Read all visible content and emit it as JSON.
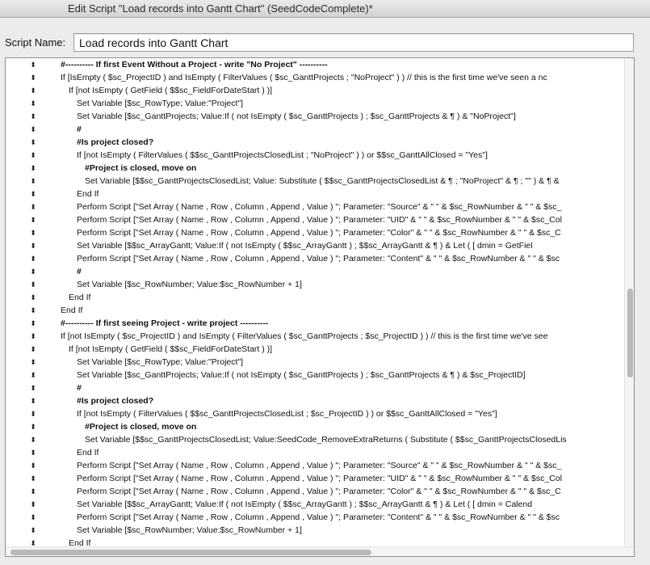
{
  "window": {
    "title": "Edit Script \"Load records into Gantt Chart\" (SeedCodeComplete)*"
  },
  "script_name": {
    "label": "Script Name:",
    "value": "Load records into Gantt Chart"
  },
  "handle_glyph": "⬍",
  "lines": [
    {
      "indent": 0,
      "comment": true,
      "text": "#----------  If first Event Without a Project - write \"No Project\"  ----------"
    },
    {
      "indent": 0,
      "comment": false,
      "text": "If [IsEmpty ( $sc_ProjectID )  and  IsEmpty ( FilterValues ( $sc_GanttProjects  ; \"NoProject\" ) ) // this is the first time we've seen a nc"
    },
    {
      "indent": 1,
      "comment": false,
      "text": "If [not IsEmpty ( GetField ( $$sc_FieldForDateStart ) )]"
    },
    {
      "indent": 2,
      "comment": false,
      "text": "Set Variable [$sc_RowType; Value:\"Project\"]"
    },
    {
      "indent": 2,
      "comment": false,
      "text": "Set Variable [$sc_GanttProjects; Value:If ( not IsEmpty ( $sc_GanttProjects ) ; $sc_GanttProjects & ¶ )  & \"NoProject\"]"
    },
    {
      "indent": 2,
      "comment": true,
      "text": "#"
    },
    {
      "indent": 2,
      "comment": true,
      "text": "#Is project closed?"
    },
    {
      "indent": 2,
      "comment": false,
      "text": "If [not IsEmpty ( FilterValues ( $$sc_GanttProjectsClosedList ; \"NoProject\" ) ) or $$sc_GanttAllClosed = \"Yes\"]"
    },
    {
      "indent": 3,
      "comment": true,
      "text": "#Project is closed, move on"
    },
    {
      "indent": 3,
      "comment": false,
      "text": "Set Variable [$$sc_GanttProjectsClosedList; Value: Substitute ( $$sc_GanttProjectsClosedList & ¶ ; \"NoProject\" & ¶ ; \"\" )  & ¶ &"
    },
    {
      "indent": 2,
      "comment": false,
      "text": "End If"
    },
    {
      "indent": 2,
      "comment": false,
      "text": "Perform Script [\"Set Array ( Name , Row , Column , Append , Value ) \"; Parameter: \"Source\" & \" \" & $sc_RowNumber & \" \" & $sc_"
    },
    {
      "indent": 2,
      "comment": false,
      "text": "Perform Script [\"Set Array ( Name , Row , Column , Append , Value ) \"; Parameter: \"UID\" & \" \" & $sc_RowNumber & \" \" & $sc_Col"
    },
    {
      "indent": 2,
      "comment": false,
      "text": "Perform Script [\"Set Array ( Name , Row , Column , Append , Value ) \"; Parameter: \"Color\" & \" \" & $sc_RowNumber & \" \" & $sc_C"
    },
    {
      "indent": 2,
      "comment": false,
      "text": "Set Variable [$$sc_ArrayGantt; Value:If ( not IsEmpty ( $$sc_ArrayGantt ) ; $$sc_ArrayGantt & ¶ )   &   Let ( [       dmin = GetFiel"
    },
    {
      "indent": 2,
      "comment": false,
      "text": "Perform Script [\"Set Array ( Name , Row , Column , Append , Value ) \"; Parameter: \"Content\" & \" \" & $sc_RowNumber & \" \" & $sc"
    },
    {
      "indent": 2,
      "comment": true,
      "text": "#"
    },
    {
      "indent": 2,
      "comment": false,
      "text": "Set Variable [$sc_RowNumber; Value:$sc_RowNumber + 1]"
    },
    {
      "indent": 1,
      "comment": false,
      "text": "End If"
    },
    {
      "indent": 0,
      "comment": false,
      "text": "End If"
    },
    {
      "indent": 0,
      "comment": true,
      "text": "#----------  If first seeing Project - write project  ----------"
    },
    {
      "indent": 0,
      "comment": false,
      "text": "If [not IsEmpty ( $sc_ProjectID )  and  IsEmpty ( FilterValues ( $sc_GanttProjects  ; $sc_ProjectID ) ) // this is the first time we've see"
    },
    {
      "indent": 1,
      "comment": false,
      "text": "If [not IsEmpty ( GetField ( $$sc_FieldForDateStart ) )]"
    },
    {
      "indent": 2,
      "comment": false,
      "text": "Set Variable [$sc_RowType; Value:\"Project\"]"
    },
    {
      "indent": 2,
      "comment": false,
      "text": "Set Variable [$sc_GanttProjects; Value:If ( not IsEmpty ( $sc_GanttProjects ) ; $sc_GanttProjects & ¶ )  & $sc_ProjectID]"
    },
    {
      "indent": 2,
      "comment": true,
      "text": "#"
    },
    {
      "indent": 2,
      "comment": true,
      "text": "#Is project closed?"
    },
    {
      "indent": 2,
      "comment": false,
      "text": "If [not IsEmpty ( FilterValues ( $$sc_GanttProjectsClosedList ; $sc_ProjectID ) ) or $$sc_GanttAllClosed = \"Yes\"]"
    },
    {
      "indent": 3,
      "comment": true,
      "text": "#Project is closed, move on"
    },
    {
      "indent": 3,
      "comment": false,
      "text": "Set Variable [$$sc_GanttProjectsClosedList; Value:SeedCode_RemoveExtraReturns (  Substitute ( $$sc_GanttProjectsClosedLis"
    },
    {
      "indent": 2,
      "comment": false,
      "text": "End If"
    },
    {
      "indent": 2,
      "comment": false,
      "text": "Perform Script [\"Set Array ( Name , Row , Column , Append , Value ) \"; Parameter: \"Source\" & \" \" & $sc_RowNumber & \" \" & $sc_"
    },
    {
      "indent": 2,
      "comment": false,
      "text": "Perform Script [\"Set Array ( Name , Row , Column , Append , Value ) \"; Parameter: \"UID\" & \" \" & $sc_RowNumber & \" \" & $sc_Col"
    },
    {
      "indent": 2,
      "comment": false,
      "text": "Perform Script [\"Set Array ( Name , Row , Column , Append , Value ) \"; Parameter: \"Color\" & \" \" & $sc_RowNumber & \" \" & $sc_C"
    },
    {
      "indent": 2,
      "comment": false,
      "text": "Set Variable [$$sc_ArrayGantt; Value:If ( not IsEmpty ( $$sc_ArrayGantt ) ; $$sc_ArrayGantt & ¶ )   &   Let ( [       dmin = Calend"
    },
    {
      "indent": 2,
      "comment": false,
      "text": "Perform Script [\"Set Array ( Name , Row , Column , Append , Value ) \"; Parameter: \"Content\" & \" \" & $sc_RowNumber & \" \" & $sc"
    },
    {
      "indent": 2,
      "comment": false,
      "text": "Set Variable [$sc_RowNumber; Value:$sc_RowNumber + 1]"
    },
    {
      "indent": 1,
      "comment": false,
      "text": "End If"
    }
  ]
}
